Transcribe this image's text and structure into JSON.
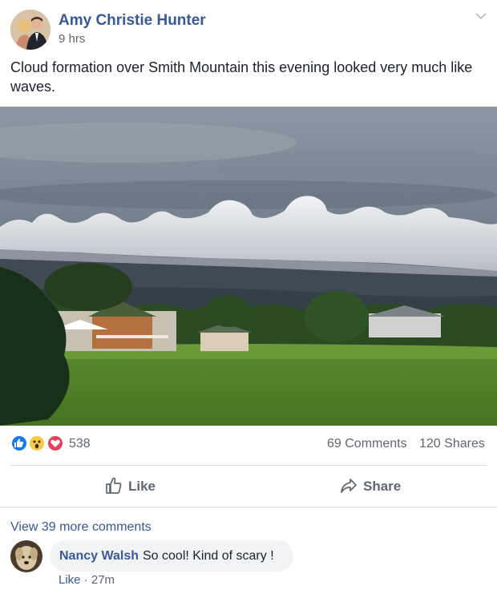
{
  "post": {
    "author": "Amy Christie Hunter",
    "time": "9 hrs",
    "text": "Cloud formation over Smith Mountain this evening looked very much like waves."
  },
  "stats": {
    "reaction_count": "538",
    "comments": "69 Comments",
    "shares": "120 Shares",
    "reaction_icons": [
      "like-reaction-icon",
      "wow-reaction-icon",
      "love-reaction-icon"
    ]
  },
  "actions": {
    "like": "Like",
    "share": "Share"
  },
  "comments": {
    "view_more": "View 39 more comments",
    "items": [
      {
        "name": "Nancy Walsh",
        "text": "So cool! Kind of scary !",
        "like": "Like",
        "time": " · 27m"
      }
    ]
  },
  "colors": {
    "link": "#385898",
    "secondary_text": "#606770",
    "like_blue": "#1877f2",
    "love_red": "#e4405f",
    "wow_yellow": "#f7c84a"
  }
}
